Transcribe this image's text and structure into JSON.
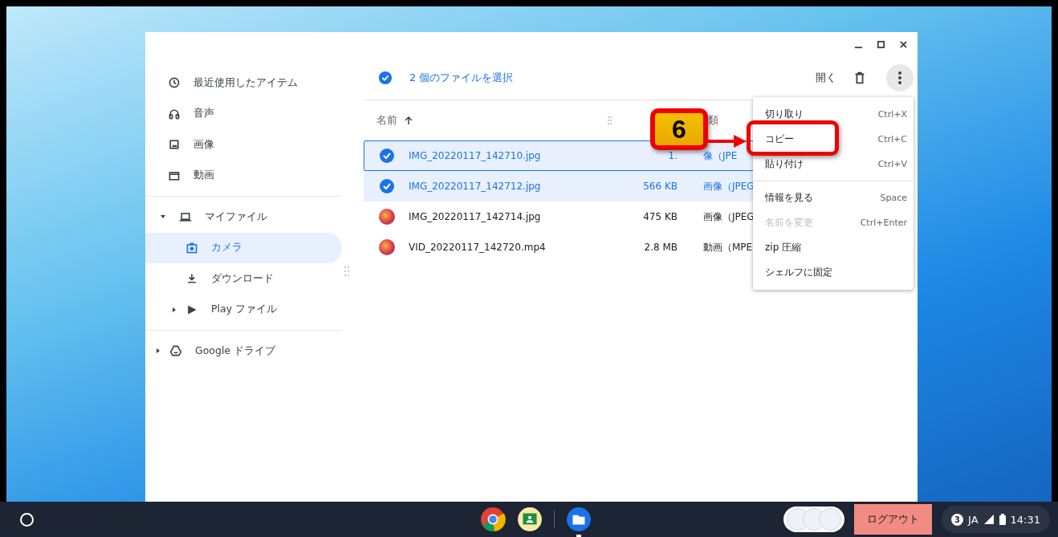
{
  "sidebar": {
    "items": [
      {
        "label": "最近使用したアイテム",
        "kind": "recent",
        "selected": false
      },
      {
        "label": "音声",
        "kind": "audio",
        "selected": false
      },
      {
        "label": "画像",
        "kind": "images",
        "selected": false
      },
      {
        "label": "動画",
        "kind": "videos",
        "selected": false
      }
    ],
    "tree": [
      {
        "label": "マイファイル",
        "kind": "computer",
        "expanded": true,
        "selected": false,
        "children": [
          {
            "label": "カメラ",
            "kind": "camera",
            "selected": true
          },
          {
            "label": "ダウンロード",
            "kind": "downloads",
            "selected": false
          },
          {
            "label": "Play ファイル",
            "kind": "play",
            "selected": false,
            "expanded": false
          }
        ]
      },
      {
        "label": "Google ドライブ",
        "kind": "drive",
        "expanded": false,
        "selected": false
      }
    ]
  },
  "toolbar": {
    "selection_text": "2 個のファイルを選択",
    "open_label": "開く"
  },
  "table": {
    "columns": [
      {
        "label": "名前"
      },
      {
        "label": "類"
      }
    ],
    "rows": [
      {
        "name": "IMG_20220117_142710.jpg",
        "size": "1.",
        "type": "像（JPE",
        "selected": true,
        "focused": true
      },
      {
        "name": "IMG_20220117_142712.jpg",
        "size": "566 KB",
        "type": "画像（JPEG",
        "selected": true,
        "focused": false
      },
      {
        "name": "IMG_20220117_142714.jpg",
        "size": "475 KB",
        "type": "画像（JPEG",
        "selected": false,
        "focused": false
      },
      {
        "name": "VID_20220117_142720.mp4",
        "size": "2.8 MB",
        "type": "動画（MPE",
        "selected": false,
        "focused": false
      }
    ]
  },
  "context_menu": [
    {
      "label": "切り取り",
      "shortcut": "Ctrl+X",
      "disabled": false,
      "divider_after": false
    },
    {
      "label": "コピー",
      "shortcut": "Ctrl+C",
      "disabled": false,
      "divider_after": false
    },
    {
      "label": "貼り付け",
      "shortcut": "Ctrl+V",
      "disabled": false,
      "divider_after": true
    },
    {
      "label": "情報を見る",
      "shortcut": "Space",
      "disabled": false,
      "divider_after": false
    },
    {
      "label": "名前を変更",
      "shortcut": "Ctrl+Enter",
      "disabled": true,
      "divider_after": false
    },
    {
      "label": "zip 圧縮",
      "disabled": false,
      "divider_after": false
    },
    {
      "label": "シェルフに固定",
      "disabled": false,
      "divider_after": false
    }
  ],
  "callout": {
    "number": "6"
  },
  "taskbar": {
    "logout_label": "ログアウト",
    "notification_count": "3",
    "ime": "JA",
    "time": "14:31"
  }
}
